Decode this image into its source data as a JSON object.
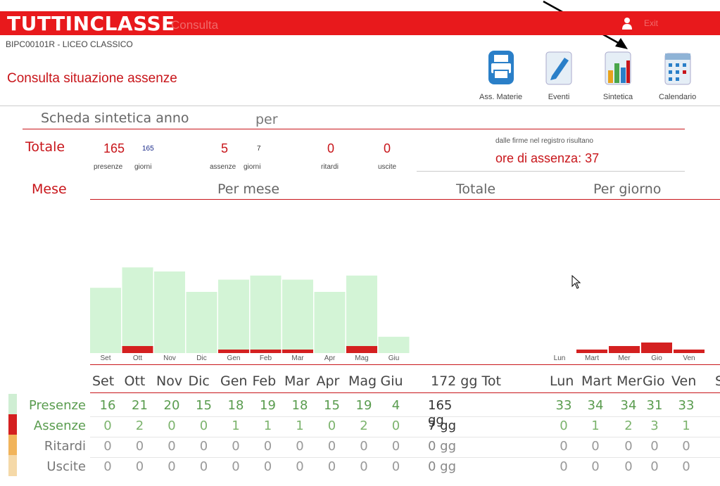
{
  "header": {
    "brand": "TUTTINCLASSE",
    "section": "Consulta",
    "user_name": "Exit",
    "school": "BIPC00101R - LICEO CLASSICO",
    "page_title": "Consulta situazione assenze"
  },
  "toolbar": {
    "ass_materie": "Ass. Materie",
    "eventi": "Eventi",
    "sintetica": "Sintetica",
    "calendario": "Calendario"
  },
  "summary": {
    "scheda_title": "Scheda sintetica anno",
    "scheda_per": "per",
    "totale_label": "Totale",
    "presenze": "165",
    "presenze_giorni": "165",
    "presenze_caption": "presenze",
    "giorni_caption": "giorni",
    "assenze": "5",
    "assenze_giorni": "7",
    "assenze_caption": "assenze",
    "giorni2_caption": "giorni",
    "ritardi": "0",
    "ritardi_caption": "ritardi",
    "uscite": "0",
    "uscite_caption": "uscite",
    "firme_note": "dalle firme nel registro risultano",
    "ore_assenza": "ore di assenza: 37"
  },
  "columns": {
    "mese": "Mese",
    "per_mese": "Per mese",
    "totale": "Totale",
    "per_giorno": "Per giorno"
  },
  "chart_data": [
    {
      "type": "bar",
      "categories": [
        "Set",
        "Ott",
        "Nov",
        "Dic",
        "Gen",
        "Feb",
        "Mar",
        "Apr",
        "Mag",
        "Giu"
      ],
      "series": [
        {
          "name": "Presenze",
          "values": [
            16,
            21,
            20,
            15,
            18,
            19,
            18,
            15,
            19,
            4
          ]
        },
        {
          "name": "Assenze",
          "values": [
            0,
            2,
            0,
            0,
            1,
            1,
            1,
            0,
            2,
            0
          ]
        }
      ],
      "ylim": [
        0,
        25
      ]
    },
    {
      "type": "bar",
      "categories": [
        "Lun",
        "Mart",
        "Mer",
        "Gio",
        "Ven"
      ],
      "series": [
        {
          "name": "Presenze",
          "values": [
            33,
            34,
            34,
            31,
            33
          ]
        },
        {
          "name": "Assenze",
          "values": [
            0,
            1,
            2,
            3,
            1
          ]
        }
      ],
      "ylim": [
        0,
        25
      ]
    }
  ],
  "table": {
    "months": [
      "Set",
      "Ott",
      "Nov",
      "Dic",
      "Gen",
      "Feb",
      "Mar",
      "Apr",
      "Mag",
      "Giu"
    ],
    "total_header": "172 gg Tot",
    "days": [
      "Lun",
      "Mart",
      "Mer",
      "Gio",
      "Ven",
      "S"
    ],
    "rows": [
      {
        "label": "Presenze",
        "color": "#cfeed3",
        "text_color": "#5a9c4f",
        "months": [
          "16",
          "21",
          "20",
          "15",
          "18",
          "19",
          "18",
          "15",
          "19",
          "4"
        ],
        "total": "165 gg",
        "days": [
          "33",
          "34",
          "34",
          "31",
          "33"
        ]
      },
      {
        "label": "Assenze",
        "color": "#d42020",
        "text_color": "#7cb36d",
        "months": [
          "0",
          "2",
          "0",
          "0",
          "1",
          "1",
          "1",
          "0",
          "2",
          "0"
        ],
        "total": "7 gg",
        "days": [
          "0",
          "1",
          "2",
          "3",
          "1"
        ]
      },
      {
        "label": "Ritardi",
        "color": "#f1b45b",
        "text_color": "#999999",
        "months": [
          "0",
          "0",
          "0",
          "0",
          "0",
          "0",
          "0",
          "0",
          "0",
          "0"
        ],
        "total": "0 gg",
        "days": [
          "0",
          "0",
          "0",
          "0",
          "0"
        ]
      },
      {
        "label": "Uscite",
        "color": "#f5d9a8",
        "text_color": "#999999",
        "months": [
          "0",
          "0",
          "0",
          "0",
          "0",
          "0",
          "0",
          "0",
          "0",
          "0"
        ],
        "total": "0 gg",
        "days": [
          "0",
          "0",
          "0",
          "0",
          "0"
        ]
      }
    ]
  },
  "colors": {
    "brand_red": "#e8191c",
    "accent_red": "#c8151a",
    "presenze_green": "#d3f4d6",
    "assenze_red": "#d42020"
  }
}
